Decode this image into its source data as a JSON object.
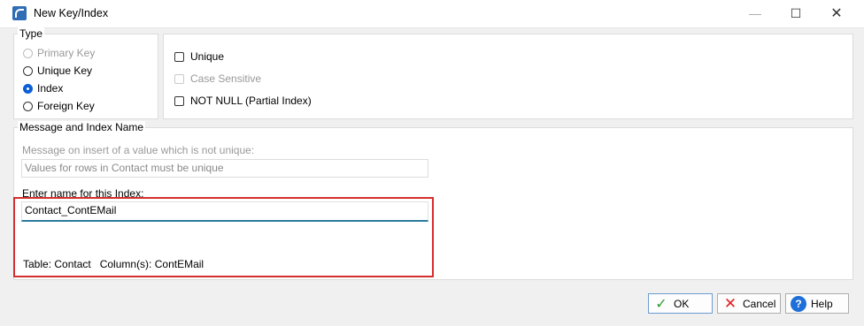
{
  "window": {
    "title": "New Key/Index",
    "minimize_icon": "minimize-icon",
    "maximize_icon": "maximize-icon",
    "close_icon": "close-icon"
  },
  "type_group": {
    "label": "Type",
    "options": [
      {
        "label": "Primary Key",
        "selected": false,
        "disabled": true
      },
      {
        "label": "Unique Key",
        "selected": false,
        "disabled": false
      },
      {
        "label": "Index",
        "selected": true,
        "disabled": false
      },
      {
        "label": "Foreign Key",
        "selected": false,
        "disabled": false
      }
    ]
  },
  "options_group": {
    "unique_label": "Unique",
    "unique_checked": false,
    "case_sensitive_label": "Case Sensitive",
    "case_sensitive_disabled": true,
    "not_null_label": "NOT NULL (Partial Index)",
    "not_null_checked": false
  },
  "message_group": {
    "label": "Message and Index Name",
    "message_prompt": "Message on insert of a value which is not unique:",
    "message_value": "Values for rows in Contact must be unique",
    "name_prompt": "Enter name for this Index:",
    "name_value": "Contact_ContEMail",
    "table_info": "Table: Contact   Column(s): ContEMail"
  },
  "buttons": {
    "ok_label": "OK",
    "cancel_label": "Cancel",
    "help_label": "Help"
  },
  "colors": {
    "highlight": "#d32f2f",
    "accent": "#0b5ed7"
  }
}
